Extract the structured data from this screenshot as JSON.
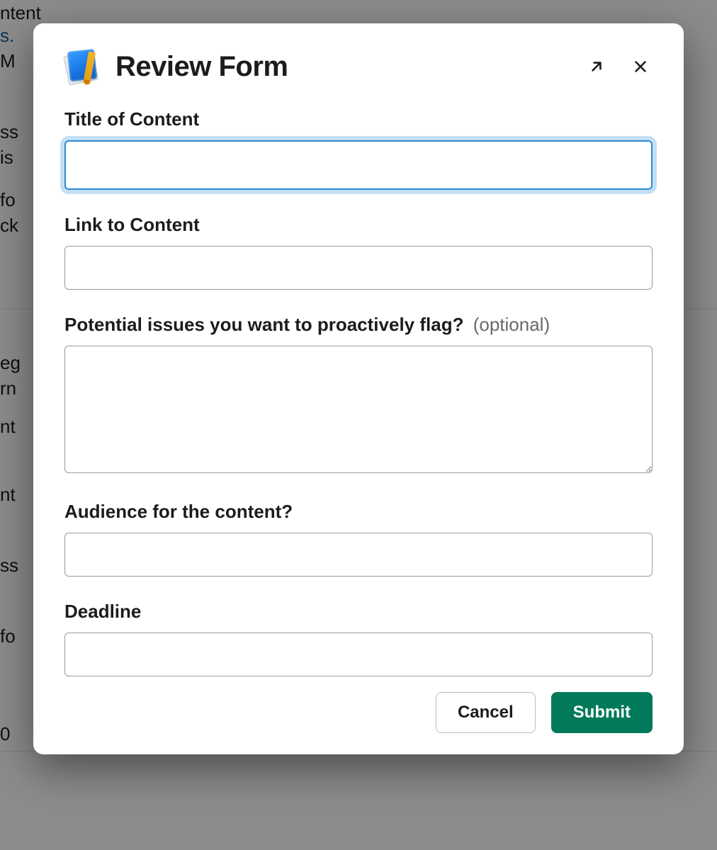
{
  "modal": {
    "title": "Review Form",
    "icon_name": "book-pencil-icon"
  },
  "fields": {
    "title": {
      "label": "Title of Content",
      "value": "",
      "placeholder": ""
    },
    "link": {
      "label": "Link to Content",
      "value": "",
      "placeholder": ""
    },
    "issues": {
      "label": "Potential issues you want to proactively flag?",
      "hint": "(optional)",
      "value": "",
      "placeholder": ""
    },
    "audience": {
      "label": "Audience for the content?",
      "value": "",
      "placeholder": ""
    },
    "deadline": {
      "label": "Deadline",
      "value": "",
      "placeholder": ""
    }
  },
  "actions": {
    "cancel": "Cancel",
    "submit": "Submit"
  },
  "background_fragments": {
    "a": "ntent",
    "b": "s.",
    "c": "M",
    "d": "ss",
    "e": "is",
    "f": "fo",
    "g": "ck",
    "h": "eg",
    "i": "rn",
    "j": "nt",
    "k": "nt",
    "l": "ss",
    "m": "fo",
    "n": "0"
  }
}
